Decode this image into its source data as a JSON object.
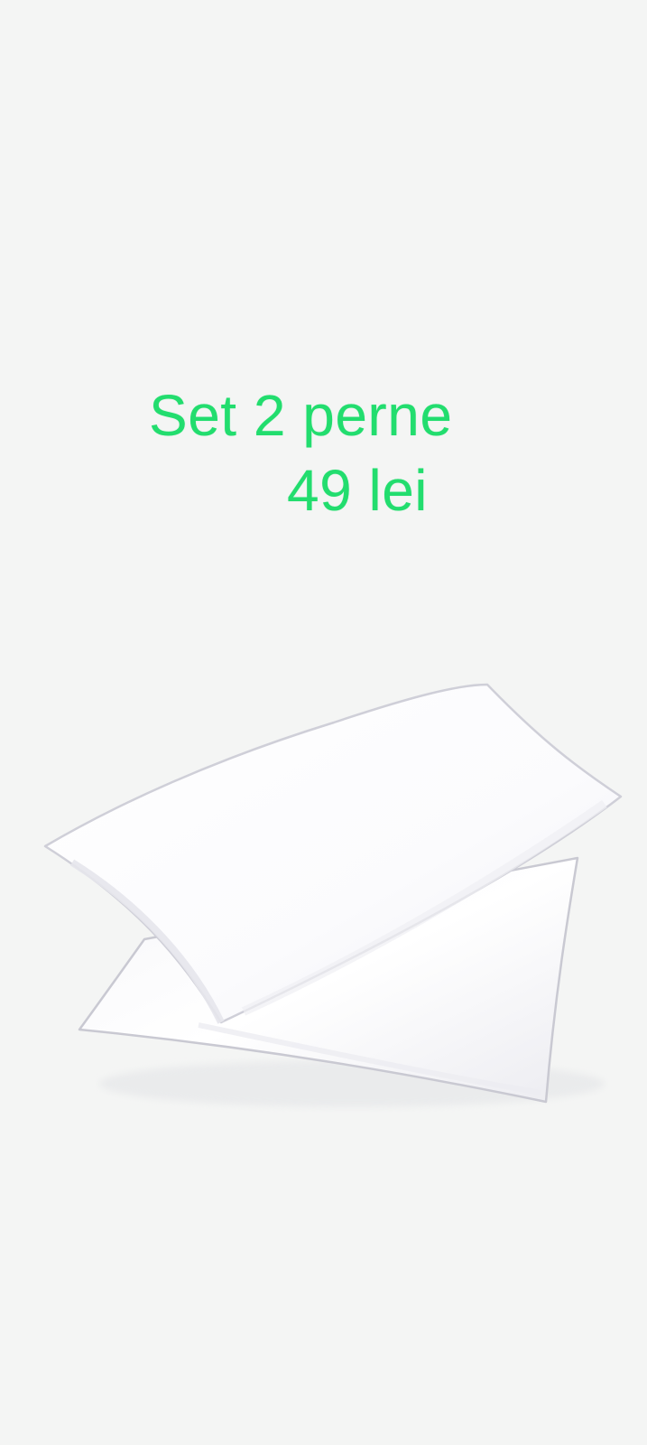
{
  "offer": {
    "title": "Set 2 perne",
    "price": "49 lei"
  },
  "image": {
    "subject": "pillows-illustration"
  },
  "colors": {
    "background": "#f4f5f4",
    "accent_text": "#22dd6e",
    "pillow": "#ffffff"
  }
}
